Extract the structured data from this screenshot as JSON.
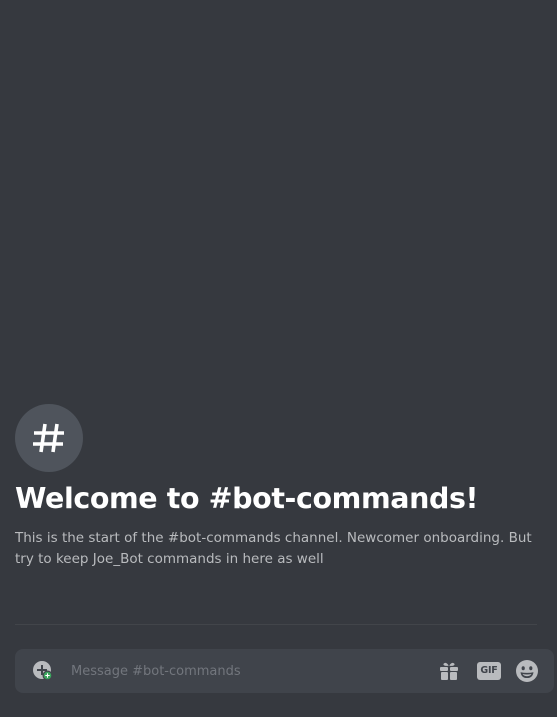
{
  "channel": {
    "welcome_title": "Welcome to #bot-commands!",
    "welcome_description": "This is the start of the #bot-commands channel. Newcomer onboarding. But try to keep Joe_Bot commands in here as well",
    "channel_icon": "hash-icon"
  },
  "composer": {
    "placeholder": "Message #bot-commands",
    "value": "",
    "gif_label": "GIF",
    "icons": {
      "attach": "plus-circle-icon",
      "gift": "gift-icon",
      "gif": "gif-icon",
      "emoji": "emoji-icon"
    }
  },
  "colors": {
    "background": "#36393f",
    "composer_bg": "#40444b",
    "title": "#ffffff",
    "description": "#b9bbbe",
    "icon": "#b9bbbe",
    "online_badge": "#3ba55d"
  }
}
